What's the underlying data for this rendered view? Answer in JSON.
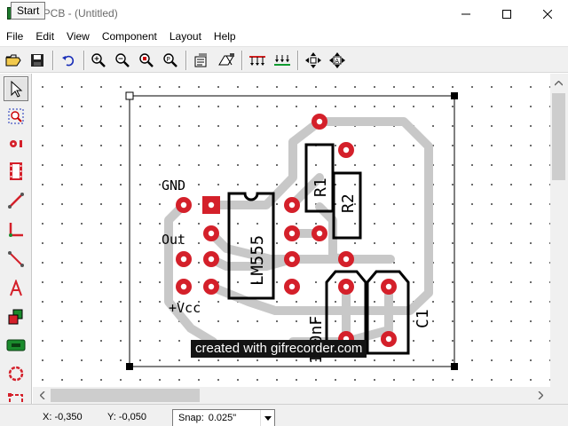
{
  "window": {
    "title": "ExpressPCB - (Untitled)",
    "visible_title": "essPCB - (Untitled)",
    "tooltip": "Start"
  },
  "menu": [
    "File",
    "Edit",
    "View",
    "Component",
    "Layout",
    "Help"
  ],
  "toolbar": {
    "buttons": [
      "open-icon",
      "save-icon",
      "undo-icon",
      "zoom-in-icon",
      "zoom-out-icon",
      "zoom-fit-icon",
      "zoom-previous-icon",
      "component-properties-icon",
      "board-icon",
      "ratsnest-icon",
      "ground-icon",
      "pan-icon",
      "auto-route-icon"
    ]
  },
  "palette": {
    "tools": [
      "select-tool",
      "zoom-box-tool",
      "pad-tool",
      "component-tool",
      "trace-tool",
      "corner-tool",
      "wire-tool",
      "text-tool",
      "layer-tool",
      "net-tool",
      "circle-tool",
      "rectangle-tool",
      "extra-tool"
    ]
  },
  "board": {
    "labels": {
      "gnd": "GND",
      "out": "Out",
      "vcc": "+Vcc",
      "ic": "LM555",
      "r1": "R1",
      "r2": "R2",
      "cap_value": "100nF",
      "c1": "C1"
    },
    "colors": {
      "trace": "#c8c8c8",
      "pad": "#d4202a",
      "silkscreen": "#000000",
      "background": "#ffffff"
    }
  },
  "watermark": "created with gifrecorder.com",
  "status": {
    "x": "X: -0,350",
    "y": "Y: -0,050",
    "snap_label": "Snap:",
    "snap_value": "0.025\""
  }
}
